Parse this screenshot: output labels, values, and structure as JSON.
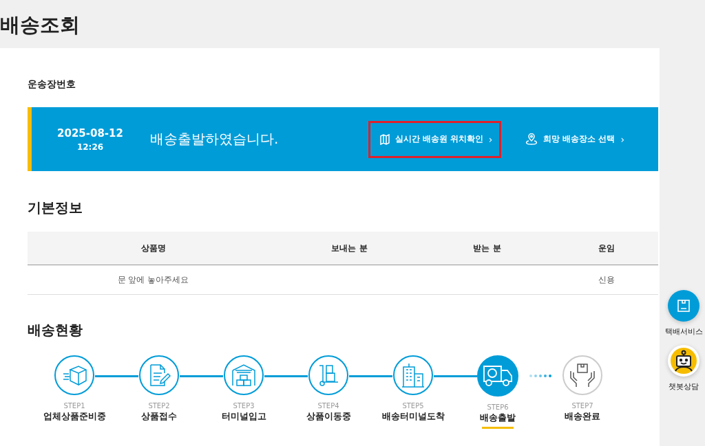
{
  "page_title": "배송조회",
  "waybill": {
    "label": "운송장번호"
  },
  "banner": {
    "date": "2025-08-12",
    "time": "12:26",
    "message": "배송출발하였습니다.",
    "links": [
      {
        "kind": "map",
        "label": "실시간 배송원 위치확인",
        "arrow": "›",
        "highlighted": true
      },
      {
        "kind": "pin",
        "label": "희망 배송장소 선택",
        "arrow": "›",
        "highlighted": false
      }
    ]
  },
  "basic_info": {
    "title": "기본정보",
    "columns": [
      "상품명",
      "보내는 분",
      "받는 분",
      "운임"
    ],
    "rows": [
      [
        "문 앞에 놓아주세요",
        "",
        "",
        "신용"
      ]
    ]
  },
  "status": {
    "title": "배송현황",
    "steps": [
      {
        "step": "STEP1",
        "label": "업체상품준비중",
        "kind": "box",
        "reached": true,
        "selected": false
      },
      {
        "step": "STEP2",
        "label": "상품접수",
        "kind": "document",
        "reached": true,
        "selected": false
      },
      {
        "step": "STEP3",
        "label": "터미널입고",
        "kind": "warehouse",
        "reached": true,
        "selected": false
      },
      {
        "step": "STEP4",
        "label": "상품이동중",
        "kind": "cart",
        "reached": true,
        "selected": false
      },
      {
        "step": "STEP5",
        "label": "배송터미널도착",
        "kind": "building",
        "reached": true,
        "selected": false
      },
      {
        "step": "STEP6",
        "label": "배송출발",
        "kind": "truck",
        "reached": true,
        "selected": true
      },
      {
        "step": "STEP7",
        "label": "배송완료",
        "kind": "hands",
        "reached": false,
        "selected": false
      }
    ]
  },
  "floating": [
    {
      "kind": "parcel",
      "label": "택배서비스"
    },
    {
      "kind": "chatbot",
      "label": "챗봇상담"
    }
  ]
}
